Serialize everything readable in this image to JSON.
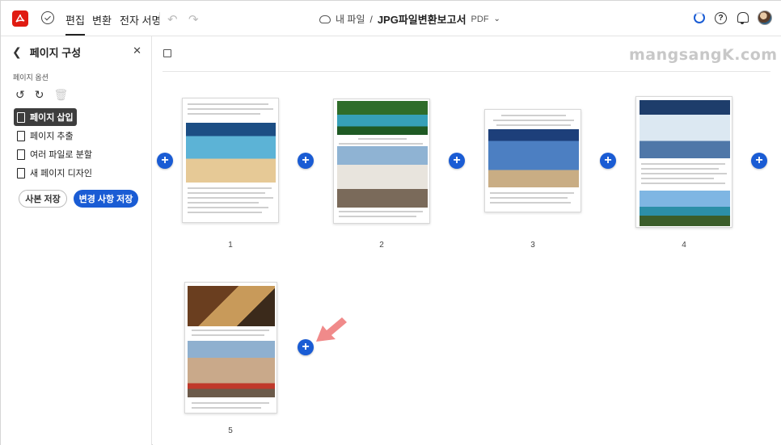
{
  "topbar": {
    "menu": [
      "편집",
      "변환",
      "전자 서명"
    ],
    "breadcrumb_root": "내 파일",
    "breadcrumb_sep": "/",
    "doc_name": "JPG파일변환보고서",
    "doc_type": "PDF",
    "help_glyph": "?"
  },
  "sidebar": {
    "title": "페이지 구성",
    "options_label": "페이지 옵션",
    "items": [
      {
        "label": "페이지 삽입"
      },
      {
        "label": "페이지 추출"
      },
      {
        "label": "여러 파일로 분할"
      },
      {
        "label": "새 페이지 디자인"
      }
    ],
    "copy_button": "사본 저장",
    "save_button": "변경 사항 저장"
  },
  "main": {
    "watermark": "mangsangK.com",
    "pages": [
      {
        "number": "1"
      },
      {
        "number": "2"
      },
      {
        "number": "3"
      },
      {
        "number": "4"
      },
      {
        "number": "5"
      }
    ]
  },
  "colors": {
    "accent": "#1a5cd4",
    "brand": "#e01b12",
    "arrow": "#f08a8a",
    "active_bg": "#3d3d3d"
  },
  "icons": [
    "acrobat-logo-icon",
    "tool-icon",
    "undo-icon",
    "redo-icon",
    "cloud-icon",
    "chevron-down-icon",
    "sync-icon",
    "help-icon",
    "bell-icon",
    "avatar",
    "back-icon",
    "close-icon",
    "rotate-left-icon",
    "rotate-right-icon",
    "trash-icon",
    "insert-icon",
    "extract-icon",
    "split-icon",
    "design-icon",
    "plus-icon",
    "arrow-icon"
  ]
}
